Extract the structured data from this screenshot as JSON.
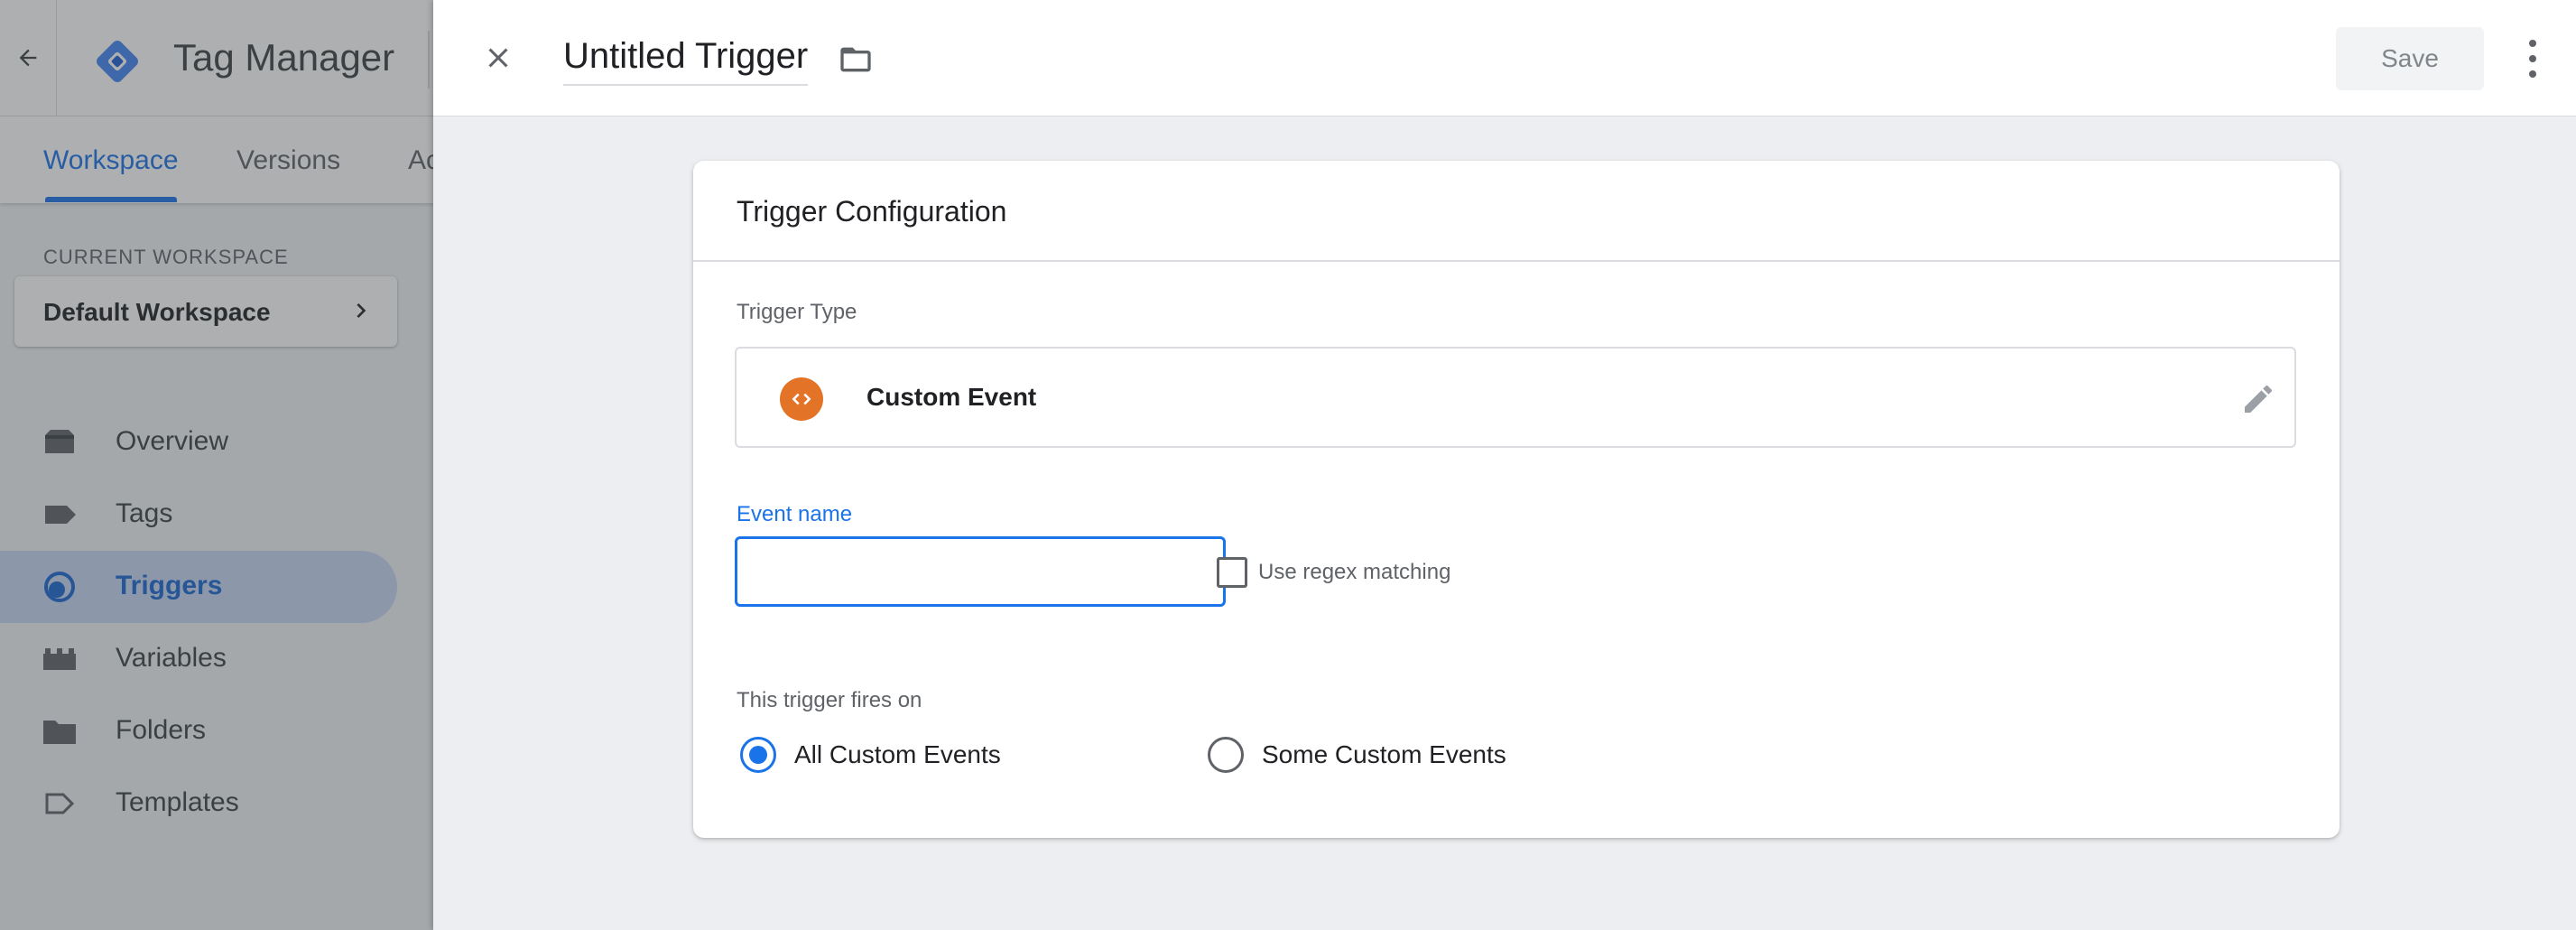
{
  "app": {
    "title": "Tag Manager",
    "tabs": [
      {
        "label": "Workspace",
        "active": true
      },
      {
        "label": "Versions",
        "active": false
      },
      {
        "label": "Ac",
        "active": false
      }
    ],
    "current_workspace_label": "CURRENT WORKSPACE",
    "current_workspace_name": "Default Workspace",
    "nav": [
      {
        "label": "Overview",
        "icon": "overview-icon",
        "active": false
      },
      {
        "label": "Tags",
        "icon": "tag-icon",
        "active": false
      },
      {
        "label": "Triggers",
        "icon": "trigger-icon",
        "active": true
      },
      {
        "label": "Variables",
        "icon": "variables-icon",
        "active": false
      },
      {
        "label": "Folders",
        "icon": "folder-icon",
        "active": false
      },
      {
        "label": "Templates",
        "icon": "template-icon",
        "active": false
      }
    ]
  },
  "panel": {
    "trigger_name": "Untitled Trigger",
    "save_label": "Save",
    "card": {
      "title": "Trigger Configuration",
      "trigger_type_label": "Trigger Type",
      "trigger_type_name": "Custom Event",
      "event_name_label": "Event name",
      "event_name_value": "",
      "regex_label": "Use regex matching",
      "regex_checked": false,
      "fires_on_label": "This trigger fires on",
      "fires_on_options": [
        {
          "label": "All Custom Events",
          "selected": true
        },
        {
          "label": "Some Custom Events",
          "selected": false
        }
      ]
    }
  },
  "colors": {
    "accent": "#1a73e8",
    "custom_event_icon": "#e37427",
    "active_nav_bg": "#c6d6f5"
  }
}
